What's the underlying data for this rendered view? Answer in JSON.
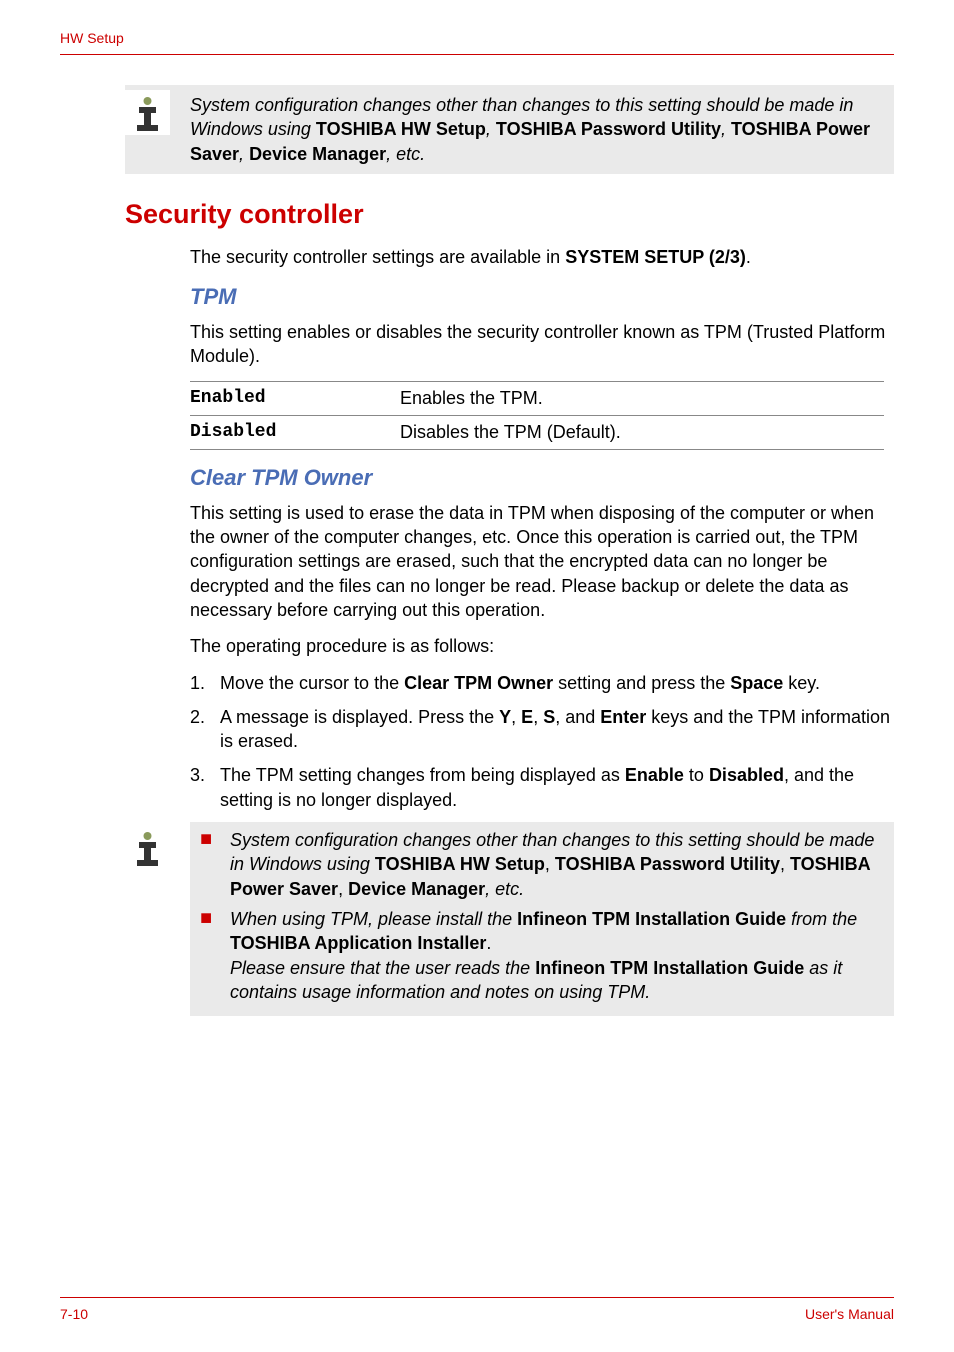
{
  "header": "HW Setup",
  "note1": {
    "part1": "System configuration changes other than changes to this setting should be made in Windows using ",
    "b1": "TOSHIBA HW Setup",
    "sep1": ", ",
    "b2": "TOSHIBA Password Utility",
    "sep2": ", ",
    "b3": "TOSHIBA Power Saver",
    "sep3": ", ",
    "b4": "Device Manager",
    "end": ", etc."
  },
  "section_title": "Security controller",
  "intro": {
    "p1a": "The security controller settings are available in ",
    "p1b": "SYSTEM SETUP (2/3)",
    "p1c": "."
  },
  "tpm": {
    "title": "TPM",
    "desc": "This setting enables or disables the security controller known as TPM (Trusted Platform Module).",
    "rows": [
      {
        "key": "Enabled",
        "val": "Enables the TPM."
      },
      {
        "key": "Disabled",
        "val": "Disables the TPM (Default)."
      }
    ]
  },
  "clear": {
    "title": "Clear TPM Owner",
    "desc": "This setting is used to erase the data in TPM when disposing of the computer or when the owner of the computer changes, etc. Once this operation is carried out, the TPM configuration settings are erased, such that the encrypted data can no longer be decrypted and the files can no longer be read. Please backup or delete the data as necessary before carrying out this operation.",
    "proc": "The operating procedure is as follows:",
    "steps": {
      "s1a": "Move the cursor to the ",
      "s1b": "Clear TPM Owner",
      "s1c": " setting and press the ",
      "s1d": "Space",
      "s1e": " key.",
      "s2a": "A message is displayed. Press the ",
      "s2y": "Y",
      "s2sep": ", ",
      "s2e": "E",
      "s2s": "S",
      "s2and": ", and ",
      "s2enter": "Enter",
      "s2end": " keys and the TPM information is erased.",
      "s3a": "The TPM setting changes from being displayed as ",
      "s3b": "Enable",
      "s3c": " to ",
      "s3d": "Disabled",
      "s3e": ", and the setting is no longer displayed."
    }
  },
  "note2": {
    "b1": {
      "t1": "System configuration changes other than changes to this setting should be made in Windows using ",
      "hw": "TOSHIBA HW Setup",
      "sep1": ", ",
      "pw": "TOSHIBA Password Utility",
      "sep2": ", ",
      "ps": "TOSHIBA Power Saver",
      "sep3": ", ",
      "dm": "Device Manager",
      "end": ", etc."
    },
    "b2": {
      "t1": "When using TPM, please install the ",
      "g1": "Infineon TPM Installation Guide",
      "t2": " from the ",
      "ai": "TOSHIBA Application Installer",
      "t3": ".",
      "t4": "Please ensure that the user reads the ",
      "g2": "Infineon TPM Installation Guide",
      "t5": " as it contains usage information and notes on using TPM."
    }
  },
  "footer": {
    "left": "7-10",
    "right": "User's Manual"
  }
}
